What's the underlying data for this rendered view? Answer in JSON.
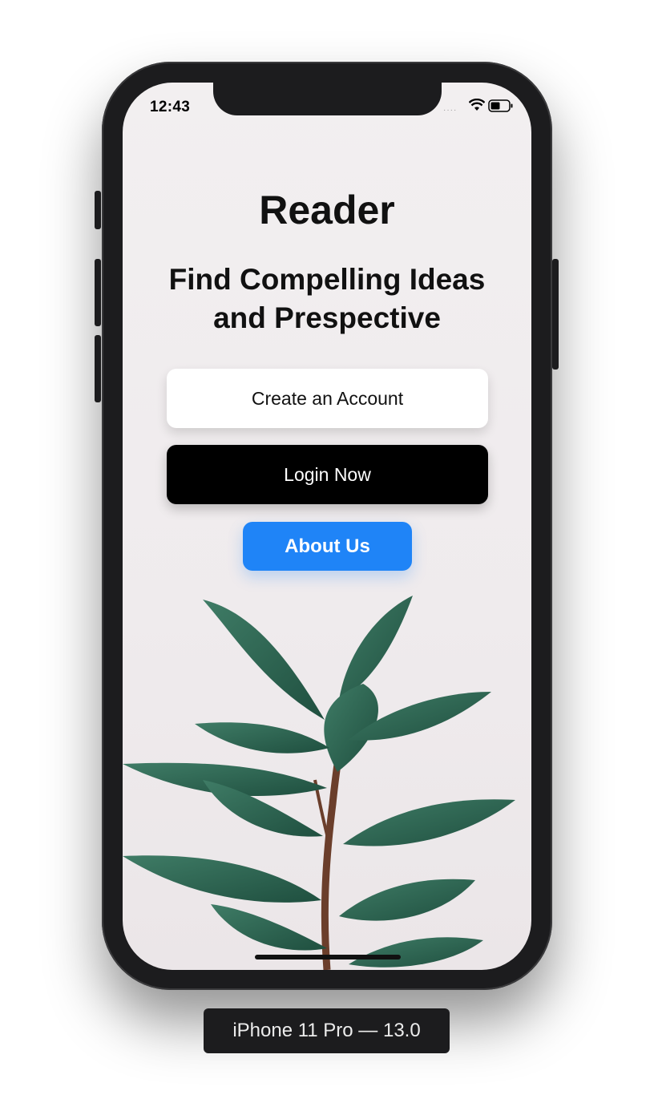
{
  "status_bar": {
    "time": "12:43"
  },
  "app": {
    "title": "Reader",
    "subtitle_line1": "Find Compelling Ideas",
    "subtitle_line2": "and Prespective"
  },
  "buttons": {
    "create_account": "Create an Account",
    "login": "Login Now",
    "about": "About Us"
  },
  "device_label": "iPhone 11 Pro — 13.0",
  "colors": {
    "about_button": "#1f84f7",
    "login_button": "#000000",
    "create_button": "#ffffff",
    "screen_background": "#f0ecee",
    "leaf": "#2f6a55"
  },
  "icons": [
    "cellular-signal-icon",
    "wifi-icon",
    "battery-icon"
  ],
  "background_image": "plant-leaves-illustration"
}
